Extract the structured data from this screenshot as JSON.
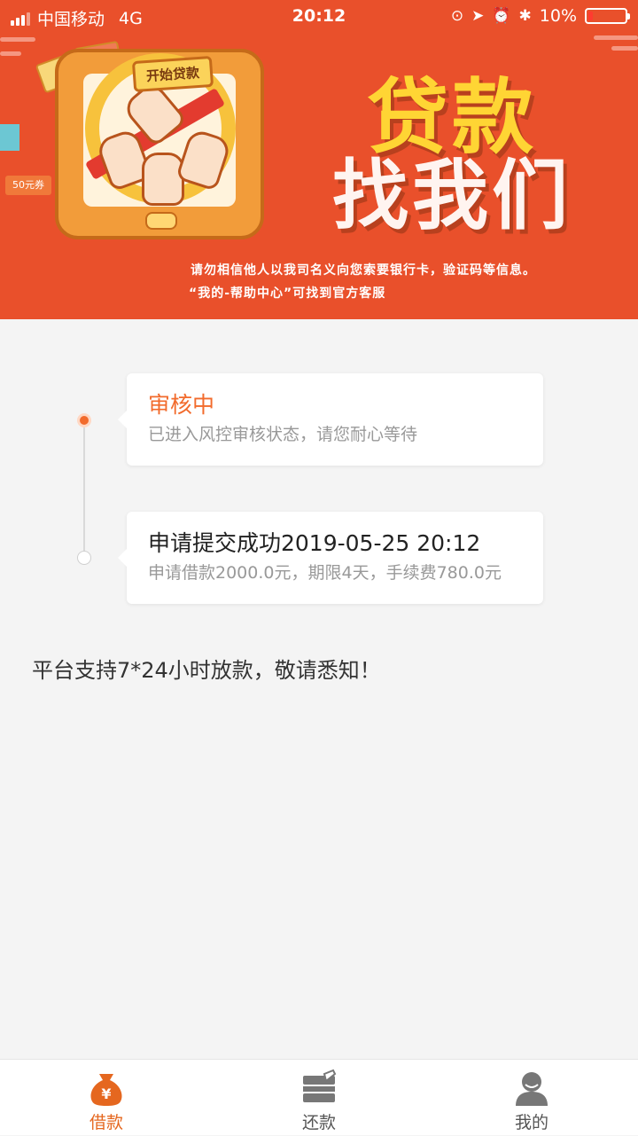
{
  "status_bar": {
    "carrier": "中国移动",
    "network": "4G",
    "time": "20:12",
    "battery": "10%",
    "icons": [
      "lock-rotation-icon",
      "location-icon",
      "alarm-icon",
      "bluetooth-icon"
    ]
  },
  "banner": {
    "button_label": "开始贷款",
    "headline_line1": "贷款",
    "headline_line2": "找我们",
    "notice_line1": "请勿相信他人以我司名义向您索要银行卡，验证码等信息。",
    "notice_line2": "“我的-帮助中心”可找到官方客服",
    "coin_label": "50元券"
  },
  "timeline": [
    {
      "title": "审核中",
      "subtitle": "已进入风控审核状态，请您耐心等待",
      "active": true
    },
    {
      "title": "申请提交成功2019-05-25 20:12",
      "subtitle": "申请借款2000.0元，期限4天，手续费780.0元",
      "active": false
    }
  ],
  "platform_note": "平台支持7*24小时放款，敬请悉知！",
  "tabs": [
    {
      "label": "借款",
      "icon": "loan-bag-icon",
      "active": true
    },
    {
      "label": "还款",
      "icon": "repay-card-icon",
      "active": false
    },
    {
      "label": "我的",
      "icon": "user-icon",
      "active": false
    }
  ],
  "colors": {
    "accent": "#f26b2c",
    "banner_bg": "#e9502b",
    "tab_active": "#e5671f",
    "page_bg": "#f4f4f4"
  }
}
